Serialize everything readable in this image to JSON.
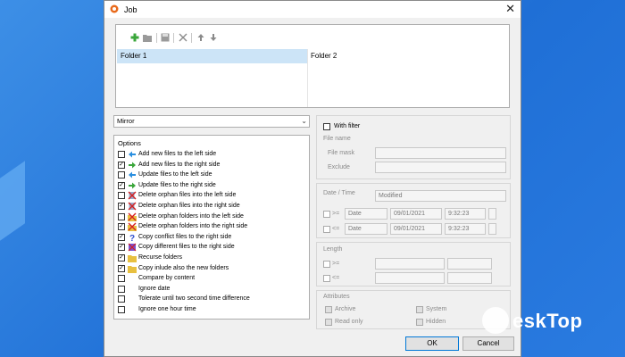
{
  "window": {
    "title": "Job",
    "close_glyph": "✕"
  },
  "toolbar": {
    "icons": [
      "add-icon",
      "folder-icon",
      "save-icon",
      "delete-icon",
      "arrow-up-icon",
      "arrow-down-icon"
    ]
  },
  "folders": {
    "left": "Folder 1",
    "right": "Folder 2"
  },
  "mode_select": {
    "value": "Mirror"
  },
  "options": {
    "title": "Options",
    "items": [
      {
        "label": "Add new files to the left side",
        "checked": false,
        "icon": "arrow-left-icon"
      },
      {
        "label": "Add new files to the right side",
        "checked": true,
        "icon": "arrow-right-icon"
      },
      {
        "label": "Update files to the left side",
        "checked": false,
        "icon": "arrow-left-icon"
      },
      {
        "label": "Update files to the right side",
        "checked": true,
        "icon": "arrow-right-icon"
      },
      {
        "label": "Delete orphan files into the left side",
        "checked": false,
        "icon": "delete-file-icon"
      },
      {
        "label": "Delete orphan files into the right side",
        "checked": true,
        "icon": "delete-file-icon"
      },
      {
        "label": "Delete orphan folders into the left side",
        "checked": false,
        "icon": "delete-folder-icon"
      },
      {
        "label": "Delete orphan folders into the right side",
        "checked": true,
        "icon": "delete-folder-icon"
      },
      {
        "label": "Copy conflict files to the right side",
        "checked": true,
        "icon": "question-icon"
      },
      {
        "label": "Copy different files to the right side",
        "checked": true,
        "icon": "diff-icon"
      },
      {
        "label": "Recurse folders",
        "checked": true,
        "icon": "folder-icon"
      },
      {
        "label": "Copy inlude also the new folders",
        "checked": true,
        "icon": "folder-icon"
      },
      {
        "label": "Compare by content",
        "checked": false,
        "icon": ""
      },
      {
        "label": "Ignore date",
        "checked": false,
        "icon": ""
      },
      {
        "label": "Tolerate until two second time difference",
        "checked": false,
        "icon": ""
      },
      {
        "label": "Ignore one hour time",
        "checked": false,
        "icon": ""
      }
    ]
  },
  "filter": {
    "with_filter_label": "With filter",
    "file_name_label": "File name",
    "file_mask_label": "File mask",
    "exclude_label": "Exclude",
    "date_time_label": "Date / Time",
    "date_type_value": "Modified",
    "ge_label": ">=",
    "le_label": "<=",
    "date_mode": "Date",
    "date1": "09/01/2021",
    "time1": "9:32:23",
    "date2": "09/01/2021",
    "time2": "9:32:23",
    "length_label": "Length",
    "attributes_label": "Attributes",
    "archive_label": "Archive",
    "system_label": "System",
    "read_only_label": "Read only",
    "hidden_label": "Hidden"
  },
  "buttons": {
    "ok": "OK",
    "cancel": "Cancel"
  },
  "watermark": {
    "text": "eskTop"
  },
  "colors": {
    "background": "#2a7be0",
    "selected_row": "#cce4f7",
    "ok_border": "#0078d7"
  }
}
